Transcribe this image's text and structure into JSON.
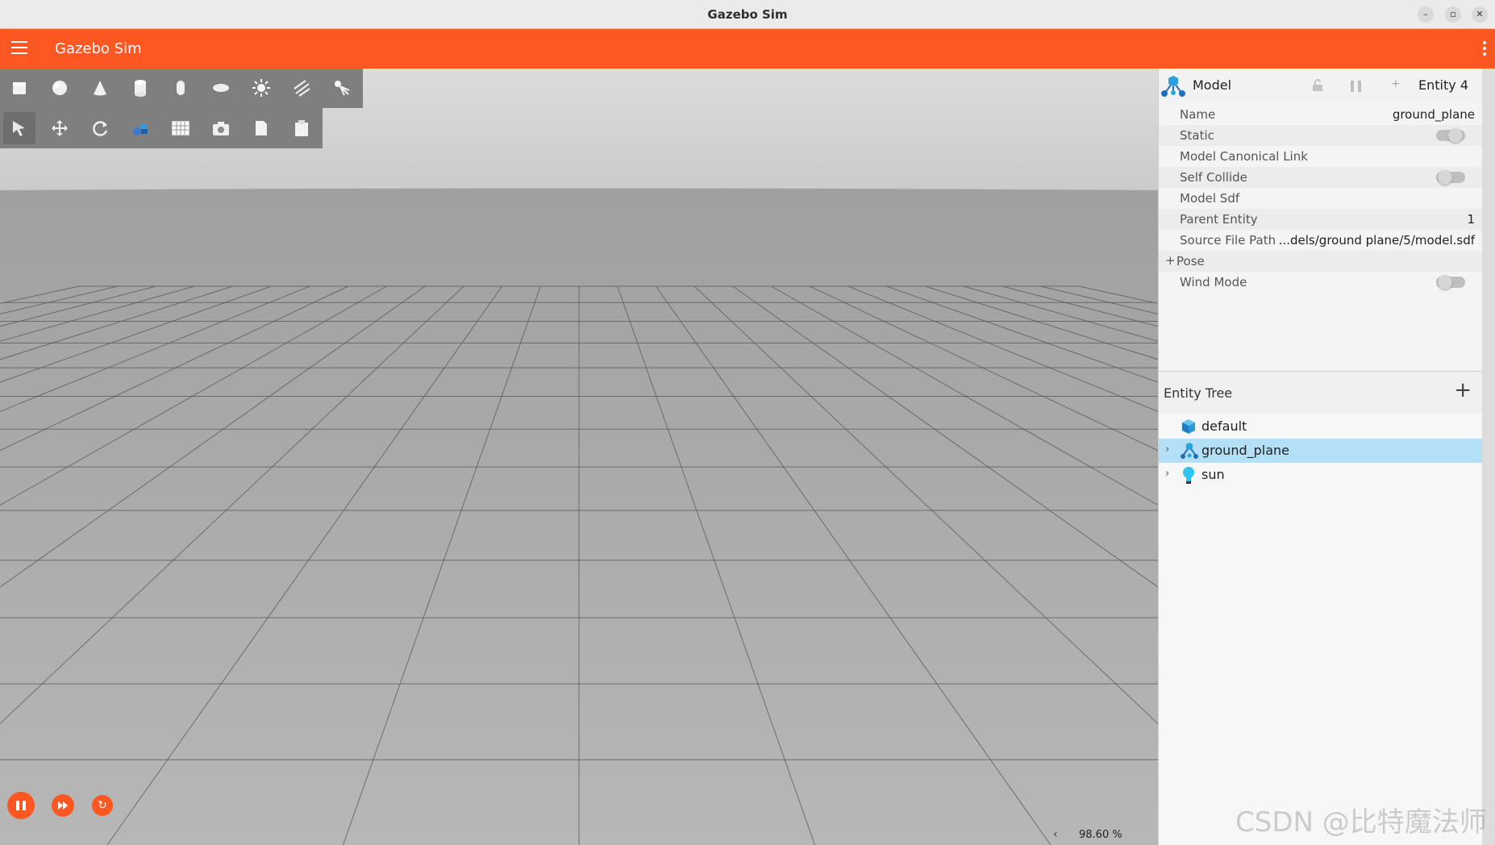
{
  "window": {
    "title": "Gazebo Sim",
    "controls": [
      "minimize-icon",
      "maximize-icon",
      "close-icon"
    ]
  },
  "app_bar": {
    "title": "Gazebo Sim",
    "accent_color": "#ff5722"
  },
  "toolbar": {
    "shapes": [
      "box-icon",
      "sphere-icon",
      "cone-icon",
      "cylinder-icon",
      "capsule-icon",
      "ellipsoid-icon",
      "point-light-icon",
      "directional-light-icon",
      "spot-light-icon"
    ],
    "tools": [
      "select-icon",
      "translate-icon",
      "rotate-icon",
      "transform-control-icon",
      "grid-snap-icon",
      "screenshot-icon",
      "copy-icon",
      "paste-icon"
    ]
  },
  "sim_controls": {
    "buttons": [
      "pause-icon",
      "step-icon",
      "reset-icon"
    ],
    "zoom_text": "98.60 %",
    "collapse_chevron": "‹"
  },
  "component_inspector": {
    "type": "Model",
    "entity": "Entity 4",
    "properties": [
      {
        "label": "Name",
        "value": "ground_plane"
      },
      {
        "label": "Static",
        "toggle": true
      },
      {
        "label": "Model Canonical Link",
        "value": ""
      },
      {
        "label": "Self Collide",
        "toggle": true
      },
      {
        "label": "Model Sdf",
        "value": ""
      },
      {
        "label": "Parent Entity",
        "value": "1"
      },
      {
        "label": "Source File Path",
        "value": "...dels/ground plane/5/model.sdf"
      },
      {
        "label": "Pose",
        "expandable": true
      },
      {
        "label": "Wind Mode",
        "toggle": true
      }
    ]
  },
  "entity_tree": {
    "title": "Entity Tree",
    "add_label": "+",
    "items": [
      {
        "label": "default",
        "icon": "world-cube-icon",
        "expandable": false,
        "selected": false
      },
      {
        "label": "ground_plane",
        "icon": "model-icon",
        "expandable": true,
        "selected": true
      },
      {
        "label": "sun",
        "icon": "light-bulb-icon",
        "expandable": true,
        "selected": false
      }
    ]
  },
  "watermark": "CSDN @比特魔法师"
}
